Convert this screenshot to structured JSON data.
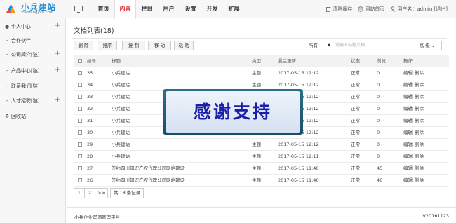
{
  "brand": {
    "title": "小兵建站",
    "subtitle": "xiaobingyso.com"
  },
  "nav": [
    "首页",
    "内容",
    "栏目",
    "用户",
    "设置",
    "开发",
    "扩展"
  ],
  "nav_active": "内容",
  "toplinks": {
    "clear_cache": "清除缓存",
    "site_home": "网站首页",
    "user": "用户名：admin [退出]"
  },
  "sidebar": [
    {
      "label": "个人中心",
      "expand": "+"
    },
    {
      "label": "合作伙伴",
      "expand": ""
    },
    {
      "label": "公司简介[链]",
      "expand": "+"
    },
    {
      "label": "产品中心[链]",
      "expand": "+"
    },
    {
      "label": "联系我们[链]",
      "expand": ""
    },
    {
      "label": "人才招聘[链]",
      "expand": "+"
    },
    {
      "label": "回收站",
      "expand": ""
    }
  ],
  "page_title": "文档列表(18)",
  "toolbar": {
    "delete": "删 除",
    "sort": "排序",
    "copy": "复 制",
    "move": "移 动",
    "paste": "粘 贴"
  },
  "filter": {
    "selected": "所有",
    "search_placeholder": "请输入标题文档",
    "advanced": "高 级"
  },
  "table": {
    "headers": {
      "id": "编号",
      "title": "标题",
      "type": "类型",
      "updated": "最后更新",
      "status": "状态",
      "views": "浏览",
      "ops": "操作"
    },
    "rows": [
      {
        "id": "35",
        "title": "小兵建站",
        "type": "主题",
        "updated": "2017-05-15 12:12",
        "status": "正常",
        "views": "0",
        "edit": "编辑",
        "del": "删除"
      },
      {
        "id": "34",
        "title": "小兵建站",
        "type": "主题",
        "updated": "2017-05-15 12:12",
        "status": "正常",
        "views": "0",
        "edit": "编辑",
        "del": "删除"
      },
      {
        "id": "33",
        "title": "小兵建站",
        "type": "主题",
        "updated": "2017-05-15 12:12",
        "status": "正常",
        "views": "0",
        "edit": "编辑",
        "del": "删除"
      },
      {
        "id": "32",
        "title": "小兵建站",
        "type": "主题",
        "updated": "2017-05-15 12:12",
        "status": "正常",
        "views": "0",
        "edit": "编辑",
        "del": "删除"
      },
      {
        "id": "31",
        "title": "小兵建站",
        "type": "主题",
        "updated": "2017-05-15 12:12",
        "status": "正常",
        "views": "0",
        "edit": "编辑",
        "del": "删除"
      },
      {
        "id": "30",
        "title": "小兵建站",
        "type": "主题",
        "updated": "2017-05-15 12:12",
        "status": "正常",
        "views": "0",
        "edit": "编辑",
        "del": "删除"
      },
      {
        "id": "29",
        "title": "小兵建站",
        "type": "主题",
        "updated": "2017-05-15 12:12",
        "status": "正常",
        "views": "0",
        "edit": "编辑",
        "del": "删除"
      },
      {
        "id": "28",
        "title": "小兵建站",
        "type": "主题",
        "updated": "2017-05-15 12:11",
        "status": "正常",
        "views": "0",
        "edit": "编辑",
        "del": "删除"
      },
      {
        "id": "27",
        "title": "签约四川知识产权代理公司网站建设",
        "type": "主题",
        "updated": "2017-05-15 11:40",
        "status": "正常",
        "views": "45",
        "edit": "编辑",
        "del": "删除"
      },
      {
        "id": "26",
        "title": "签约四川知识产权代理公司网站建设",
        "type": "主题",
        "updated": "2017-05-15 11:40",
        "status": "正常",
        "views": "46",
        "edit": "编辑",
        "del": "删除"
      }
    ]
  },
  "pager": {
    "p1": "1",
    "p2": "2",
    "next": ">>",
    "info": "共 18 条记录"
  },
  "footer": {
    "left": "小兵企业官网管理平台",
    "right": "V20161123"
  },
  "watermark": "感谢支持",
  "colors": {
    "accent": "#1f8dd6",
    "active_nav": "#e4393c"
  }
}
